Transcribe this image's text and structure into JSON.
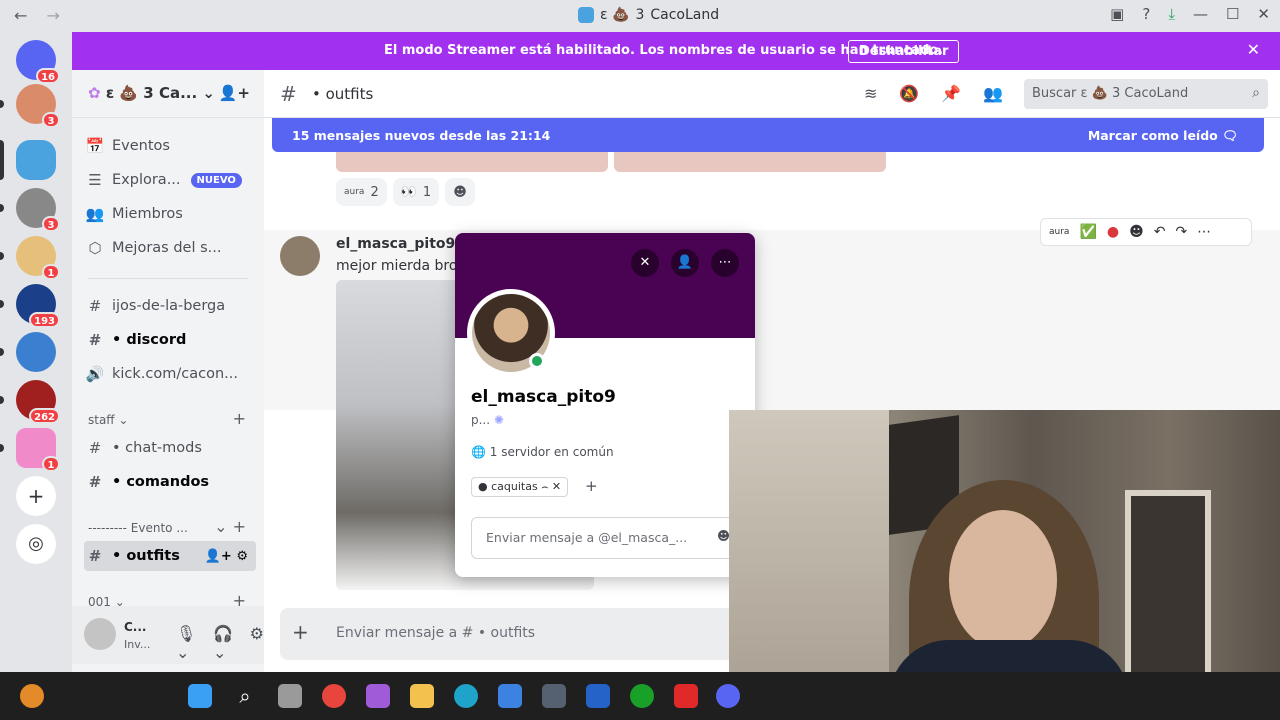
{
  "window": {
    "title": "CacoLand",
    "title_prefix_badge": "3",
    "nav_back": "←",
    "nav_forward": "→"
  },
  "rail": {
    "servers": [
      {
        "name": "discord-home",
        "badge": "16",
        "color": "#5865f2"
      },
      {
        "name": "server-avatar-1",
        "badge": "3",
        "color": "#d98b6a"
      },
      {
        "name": "server-caco",
        "badge": "",
        "color": "#4aa3df"
      },
      {
        "name": "server-bw",
        "badge": "3",
        "color": "#888888"
      },
      {
        "name": "server-anime",
        "badge": "1",
        "color": "#e6c07a"
      },
      {
        "name": "server-gamer",
        "badge": "193",
        "color": "#1c3f8a"
      },
      {
        "name": "server-egg",
        "badge": "",
        "color": "#3a7fd0"
      },
      {
        "name": "server-red",
        "badge": "262",
        "color": "#a02020"
      },
      {
        "name": "server-pink",
        "badge": "1",
        "color": "#f08ac8"
      }
    ]
  },
  "banner": {
    "text": "El modo Streamer está habilitado. Los nombres de usuario se han truncado.",
    "button": "Deshabilitar"
  },
  "guild": {
    "name": "ε 💩 3 Ca..."
  },
  "sidebar": {
    "top": [
      {
        "icon": "📅",
        "label": "Eventos"
      },
      {
        "icon": "☰",
        "label": "Explora...",
        "badge": "NUEVO"
      },
      {
        "icon": "👥",
        "label": "Miembros"
      },
      {
        "icon": "⬡",
        "label": "Mejoras del s..."
      }
    ],
    "channels": [
      {
        "label": "ijos-de-la-berga",
        "icon": "#",
        "bold": false
      },
      {
        "label": "• discord",
        "icon": "#",
        "bold": true
      },
      {
        "label": "kick.com/cacon...",
        "icon": "🔊",
        "bold": false
      }
    ],
    "categories": {
      "staff": "staff",
      "evento": "--------- Evento ...",
      "c001": "001"
    },
    "staff_channels": [
      {
        "label": "• chat-mods",
        "bold": false
      },
      {
        "label": "• comandos",
        "bold": true
      }
    ],
    "active_channel": "• outfits"
  },
  "user": {
    "name": "C...",
    "status": "Inv..."
  },
  "header": {
    "channel": "• outfits",
    "search_placeholder": "Buscar ε 💩 3 CacoLand"
  },
  "chat": {
    "new_messages": "15 mensajes nuevos desde las 21:14",
    "mark_read": "Marcar como leído",
    "reactions": [
      {
        "emoji": "aura",
        "count": "2"
      },
      {
        "emoji": "👀",
        "count": "1"
      }
    ],
    "author": "el_masca_pito9",
    "message": "mejor mierda bro",
    "composer_placeholder": "Enviar mensaje a # • outfits"
  },
  "popout": {
    "username": "el_masca_pito9",
    "pronouns": "p...",
    "mutual": "1 servidor en común",
    "role": "caquitas ⌢",
    "dm_placeholder": "Enviar mensaje a @el_masca_..."
  }
}
